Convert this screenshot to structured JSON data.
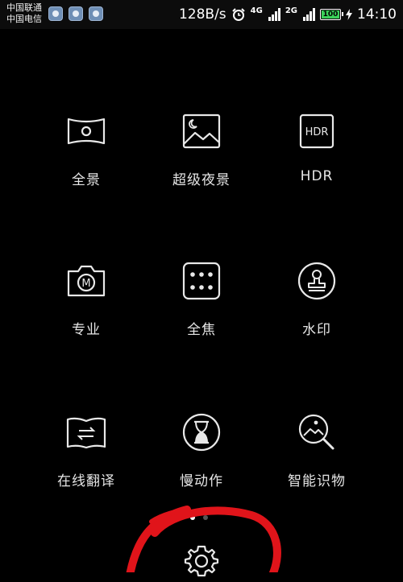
{
  "status_bar": {
    "carrier_1": "中国联通",
    "carrier_2": "中国电信",
    "net_speed": "128B/s",
    "network_1": "4G",
    "network_2": "2G",
    "battery": "100",
    "time": "14:10"
  },
  "modes": [
    {
      "label": "全景",
      "icon": "panorama-icon"
    },
    {
      "label": "超级夜景",
      "icon": "night-scene-icon"
    },
    {
      "label": "HDR",
      "icon": "hdr-icon",
      "icon_text": "HDR"
    },
    {
      "label": "专业",
      "icon": "pro-camera-icon",
      "icon_text": "M"
    },
    {
      "label": "全焦",
      "icon": "all-focus-icon"
    },
    {
      "label": "水印",
      "icon": "watermark-stamp-icon"
    },
    {
      "label": "在线翻译",
      "icon": "translate-icon"
    },
    {
      "label": "慢动作",
      "icon": "slow-motion-icon"
    },
    {
      "label": "智能识物",
      "icon": "smart-recognition-icon"
    }
  ],
  "pager": {
    "count": 2,
    "active": 1
  },
  "colors": {
    "background": "#000000",
    "annotation": "#e0141a",
    "battery": "#3bd15a"
  }
}
